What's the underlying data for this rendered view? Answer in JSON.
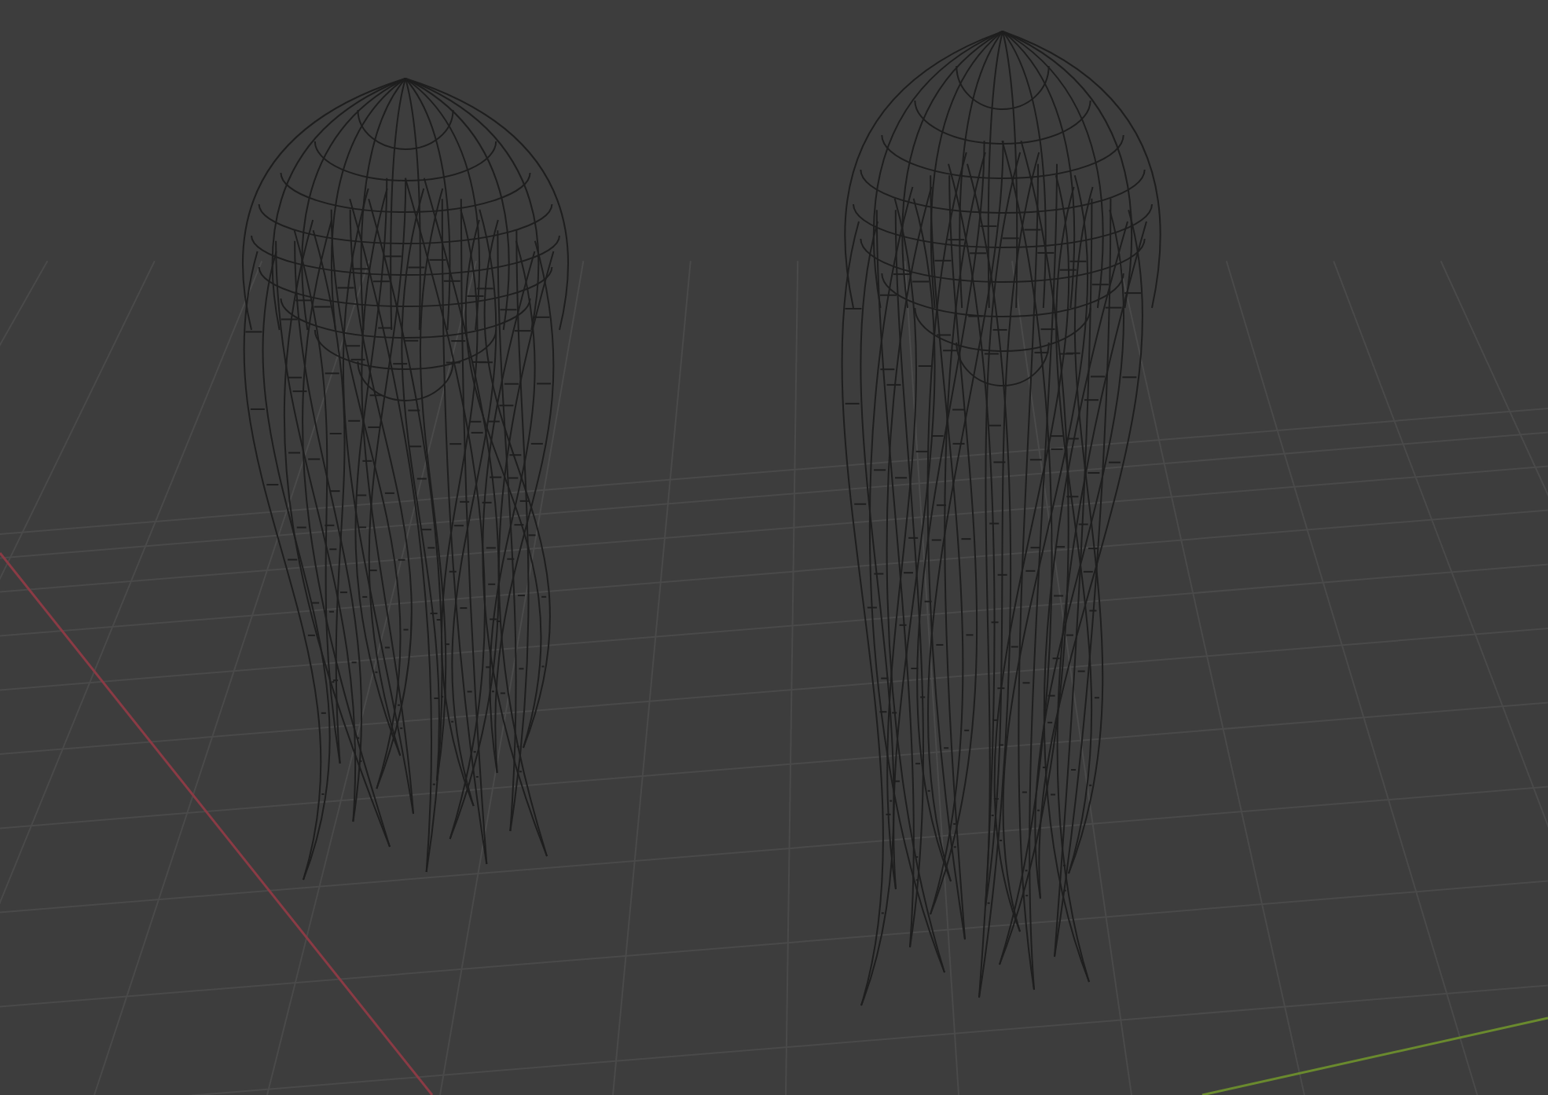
{
  "viewport": {
    "objects": [
      {
        "kind": "hair-wireframe"
      },
      {
        "kind": "hair-wireframe"
      }
    ]
  }
}
